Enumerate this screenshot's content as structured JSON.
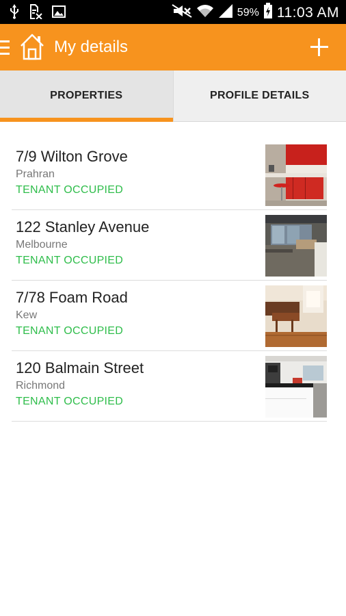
{
  "status_bar": {
    "battery_percent": "59%",
    "time": "11:03 AM"
  },
  "app_bar": {
    "title": "My details"
  },
  "tabs": [
    {
      "label": "PROPERTIES",
      "active": true
    },
    {
      "label": "PROFILE DETAILS",
      "active": false
    }
  ],
  "properties": [
    {
      "address": "7/9 Wilton Grove",
      "suburb": "Prahran",
      "status": "TENANT OCCUPIED"
    },
    {
      "address": "122 Stanley Avenue",
      "suburb": "Melbourne",
      "status": "TENANT OCCUPIED"
    },
    {
      "address": "7/78 Foam Road",
      "suburb": "Kew",
      "status": "TENANT OCCUPIED"
    },
    {
      "address": "120 Balmain Street",
      "suburb": "Richmond",
      "status": "TENANT OCCUPIED"
    }
  ],
  "colors": {
    "accent": "#f7931e",
    "status_green": "#2ebd4a"
  }
}
